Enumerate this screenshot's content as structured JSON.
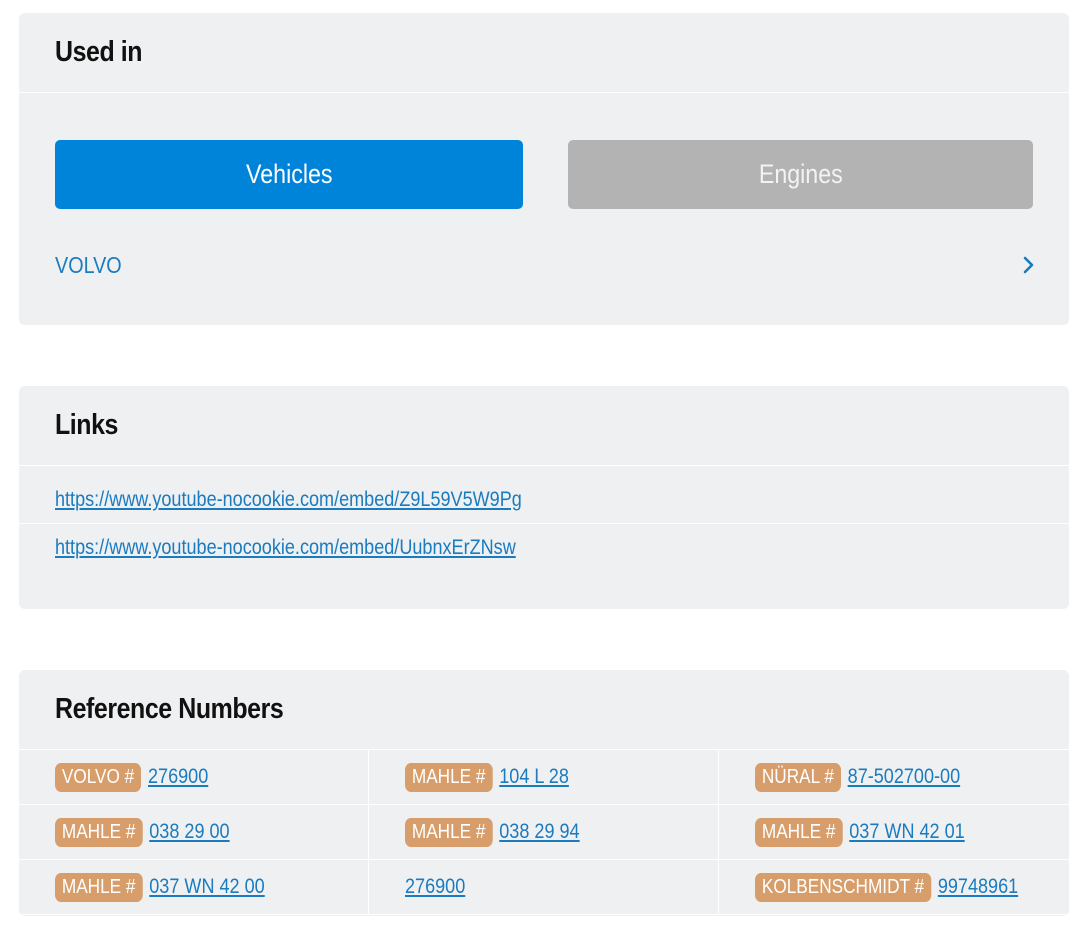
{
  "used_in": {
    "title": "Used in",
    "tabs": {
      "vehicles": "Vehicles",
      "engines": "Engines"
    },
    "active_tab": "vehicles",
    "makes": [
      "VOLVO"
    ],
    "chevron_icon": "chevron-right-icon",
    "colors": {
      "active_tab": "#0084d9",
      "inactive_tab": "#b3b3b3",
      "link": "#1a7bbf"
    }
  },
  "links": {
    "title": "Links",
    "items": [
      "https://www.youtube-nocookie.com/embed/Z9L59V5W9Pg",
      "https://www.youtube-nocookie.com/embed/UubnxErZNsw"
    ]
  },
  "reference_numbers": {
    "title": "Reference Numbers",
    "badge_color": "#d79e6b",
    "items": [
      {
        "brand": "VOLVO #",
        "number": "276900"
      },
      {
        "brand": "MAHLE #",
        "number": "104 L 28"
      },
      {
        "brand": "NÜRAL #",
        "number": "87-502700-00"
      },
      {
        "brand": "MAHLE #",
        "number": "038 29 00"
      },
      {
        "brand": "MAHLE #",
        "number": "038 29 94"
      },
      {
        "brand": "MAHLE #",
        "number": "037 WN 42 01"
      },
      {
        "brand": "MAHLE #",
        "number": "037 WN 42 00"
      },
      {
        "brand": "",
        "number": "276900"
      },
      {
        "brand": "KOLBENSCHMIDT #",
        "number": "99748961"
      }
    ]
  }
}
